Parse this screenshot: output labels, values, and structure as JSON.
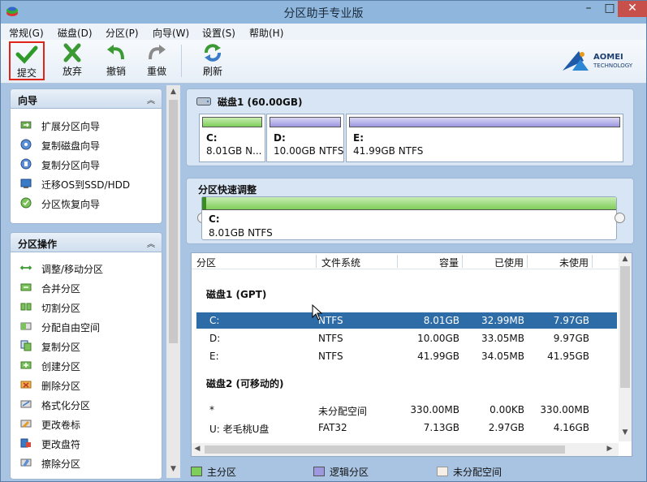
{
  "window": {
    "title": "分区助手专业版",
    "controls": {
      "minimize": "–",
      "maximize": "□",
      "close": "✕"
    }
  },
  "menu": [
    "常规(G)",
    "磁盘(D)",
    "分区(P)",
    "向导(W)",
    "设置(S)",
    "帮助(H)"
  ],
  "toolbar": {
    "submit": "提交",
    "discard": "放弃",
    "undo": "撤销",
    "redo": "重做",
    "refresh": "刷新",
    "logo_brand": "AOMEI",
    "logo_sub": "TECHNOLOGY"
  },
  "wizard_panel": {
    "title": "向导",
    "items": [
      "扩展分区向导",
      "复制磁盘向导",
      "复制分区向导",
      "迁移OS到SSD/HDD",
      "分区恢复向导"
    ]
  },
  "partition_ops_panel": {
    "title": "分区操作",
    "items": [
      "调整/移动分区",
      "合并分区",
      "切割分区",
      "分配自由空间",
      "复制分区",
      "创建分区",
      "删除分区",
      "格式化分区",
      "更改卷标",
      "更改盘符",
      "擦除分区"
    ]
  },
  "disk_map": {
    "title": "磁盘1 (60.00GB)",
    "partitions": [
      {
        "name": "C:",
        "info": "8.01GB N...",
        "type": "primary"
      },
      {
        "name": "D:",
        "info": "10.00GB NTFS",
        "type": "logical"
      },
      {
        "name": "E:",
        "info": "41.99GB NTFS",
        "type": "logical"
      }
    ]
  },
  "quick_adjust": {
    "title": "分区快速调整",
    "name": "C:",
    "info": "8.01GB NTFS"
  },
  "table": {
    "columns": [
      "分区",
      "文件系统",
      "容量",
      "已使用",
      "未使用"
    ],
    "groups": [
      {
        "title": "磁盘1 (GPT)",
        "rows": [
          {
            "partition": "C:",
            "fs": "NTFS",
            "capacity": "8.01GB",
            "used": "32.99MB",
            "free": "7.97GB"
          },
          {
            "partition": "D:",
            "fs": "NTFS",
            "capacity": "10.00GB",
            "used": "33.05MB",
            "free": "9.97GB"
          },
          {
            "partition": "E:",
            "fs": "NTFS",
            "capacity": "41.99GB",
            "used": "34.05MB",
            "free": "41.95GB"
          }
        ]
      },
      {
        "title": "磁盘2 (可移动的)",
        "rows": [
          {
            "partition": "*",
            "fs": "未分配空间",
            "capacity": "330.00MB",
            "used": "0.00KB",
            "free": "330.00MB"
          },
          {
            "partition": "U: 老毛桃U盘",
            "fs": "FAT32",
            "capacity": "7.13GB",
            "used": "2.97GB",
            "free": "4.16GB"
          }
        ]
      }
    ]
  },
  "legend": [
    "主分区",
    "逻辑分区",
    "未分配空间"
  ],
  "colors": {
    "primary": "#7fcd5a",
    "logical": "#9d98e0",
    "unallocated": "#f5efe8",
    "selection": "#2e6ca8",
    "submit_border": "#e2231a"
  }
}
